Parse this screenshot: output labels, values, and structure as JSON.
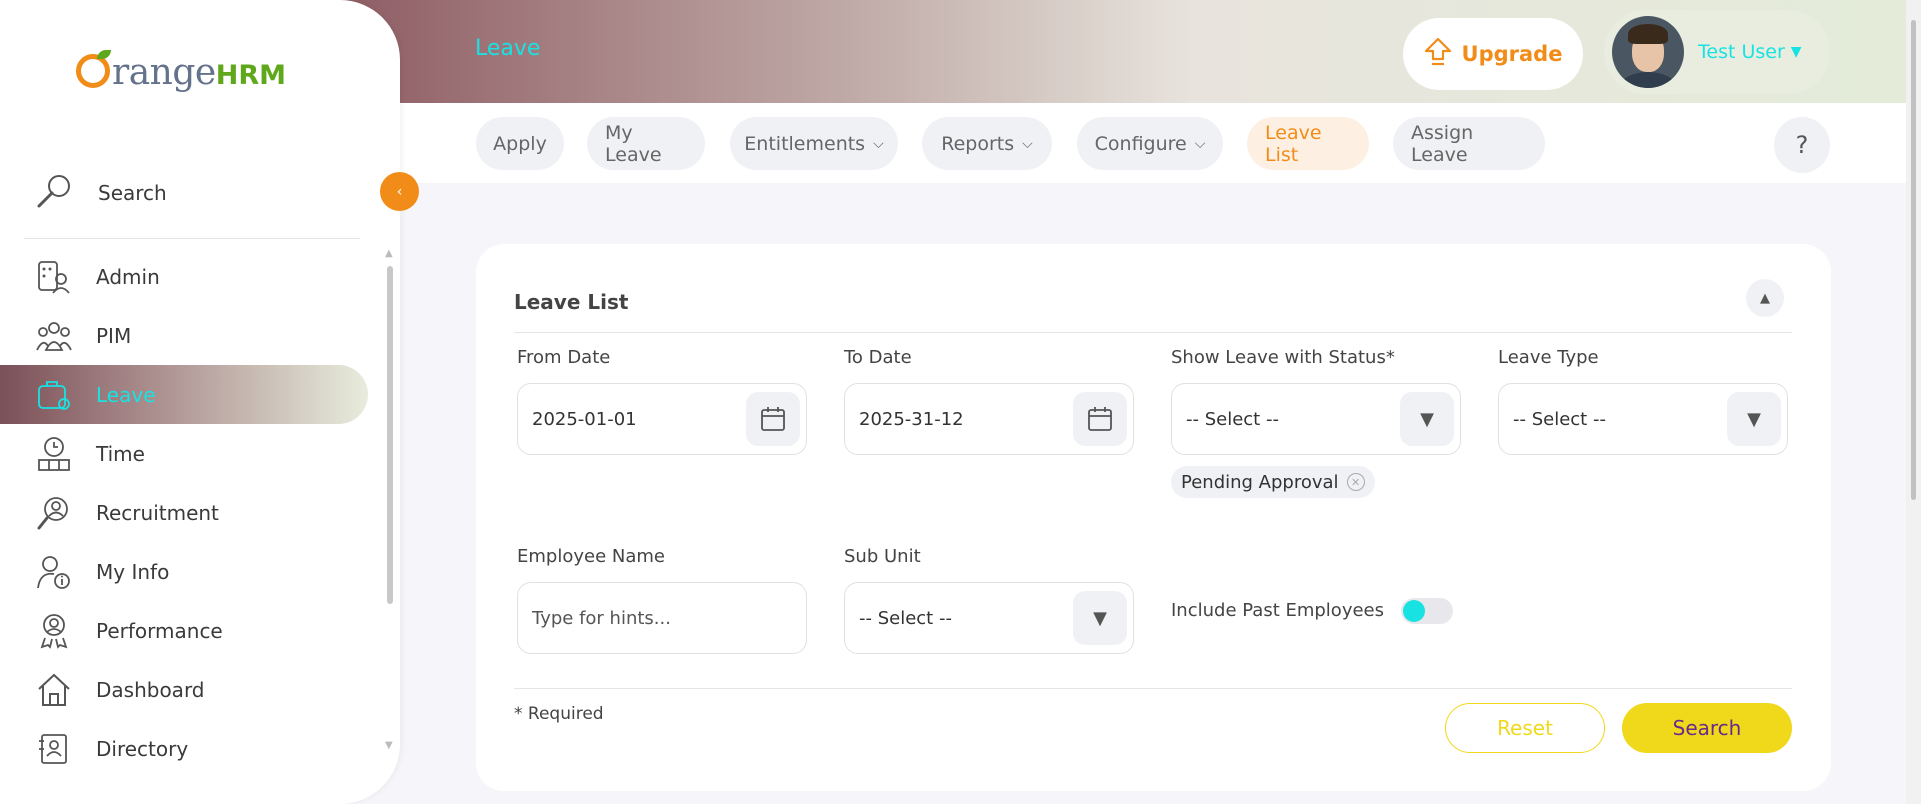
{
  "topbar": {
    "title": "Leave",
    "upgrade_label": "Upgrade",
    "user_name": "Test User"
  },
  "sidebar": {
    "brand": {
      "main": "range",
      "suffix": "HRM"
    },
    "search_label": "Search",
    "items": [
      {
        "label": "Admin",
        "icon": "admin-icon",
        "active": false
      },
      {
        "label": "PIM",
        "icon": "pim-icon",
        "active": false
      },
      {
        "label": "Leave",
        "icon": "leave-icon",
        "active": true
      },
      {
        "label": "Time",
        "icon": "time-icon",
        "active": false
      },
      {
        "label": "Recruitment",
        "icon": "recruitment-icon",
        "active": false
      },
      {
        "label": "My Info",
        "icon": "my-info-icon",
        "active": false
      },
      {
        "label": "Performance",
        "icon": "performance-icon",
        "active": false
      },
      {
        "label": "Dashboard",
        "icon": "dashboard-icon",
        "active": false
      },
      {
        "label": "Directory",
        "icon": "directory-icon",
        "active": false
      }
    ]
  },
  "tabs": [
    {
      "label": "Apply",
      "dropdown": false,
      "active": false
    },
    {
      "label": "My Leave",
      "dropdown": false,
      "active": false
    },
    {
      "label": "Entitlements",
      "dropdown": true,
      "active": false
    },
    {
      "label": "Reports",
      "dropdown": true,
      "active": false
    },
    {
      "label": "Configure",
      "dropdown": true,
      "active": false
    },
    {
      "label": "Leave List",
      "dropdown": false,
      "active": true
    },
    {
      "label": "Assign Leave",
      "dropdown": false,
      "active": false
    }
  ],
  "help_label": "?",
  "filter": {
    "title": "Leave List",
    "from_date": {
      "label": "From Date",
      "value": "2025-01-01"
    },
    "to_date": {
      "label": "To Date",
      "value": "2025-31-12"
    },
    "status": {
      "label": "Show Leave with Status*",
      "value": "-- Select --",
      "chips": [
        "Pending Approval"
      ]
    },
    "leave_type": {
      "label": "Leave Type",
      "value": "-- Select --"
    },
    "employee_name": {
      "label": "Employee Name",
      "placeholder": "Type for hints..."
    },
    "sub_unit": {
      "label": "Sub Unit",
      "value": "-- Select --"
    },
    "include_past": {
      "label": "Include Past Employees",
      "on": false
    },
    "required_note": "* Required",
    "reset_label": "Reset",
    "search_label": "Search"
  },
  "colors": {
    "accent_orange": "#f28c18",
    "accent_cyan": "#19e2e3",
    "button_yellow": "#f0d81a",
    "button_text_purple": "#6a2a8a"
  }
}
